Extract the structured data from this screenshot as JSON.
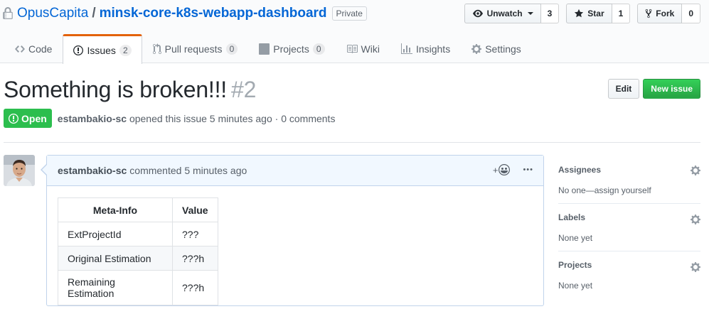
{
  "repo": {
    "owner": "OpusCapita",
    "separator": "/",
    "name": "minsk-core-k8s-webapp-dashboard",
    "visibility": "Private"
  },
  "actions": {
    "watch": {
      "label": "Unwatch",
      "count": "3"
    },
    "star": {
      "label": "Star",
      "count": "1"
    },
    "fork": {
      "label": "Fork",
      "count": "0"
    }
  },
  "tabs": [
    {
      "label": "Code",
      "icon": "code-icon"
    },
    {
      "label": "Issues",
      "icon": "issue-opened-icon",
      "counter": "2",
      "selected": true
    },
    {
      "label": "Pull requests",
      "icon": "git-pull-request-icon",
      "counter": "0"
    },
    {
      "label": "Projects",
      "icon": "project-icon",
      "counter": "0"
    },
    {
      "label": "Wiki",
      "icon": "book-icon"
    },
    {
      "label": "Insights",
      "icon": "graph-icon"
    },
    {
      "label": "Settings",
      "icon": "gear-icon"
    }
  ],
  "issue": {
    "title": "Something is broken!!!",
    "number": "#2",
    "state": "Open",
    "author": "estambakio-sc",
    "meta_text": "opened this issue 5 minutes ago · 0 comments",
    "edit_label": "Edit",
    "new_issue_label": "New issue"
  },
  "comment": {
    "author": "estambakio-sc",
    "action_text": "commented 5 minutes ago",
    "add_reaction": "+",
    "more": "•••",
    "table": {
      "headers": [
        "Meta-Info",
        "Value"
      ],
      "rows": [
        [
          "ExtProjectId",
          "???"
        ],
        [
          "Original Estimation",
          "???h"
        ],
        [
          "Remaining Estimation",
          "???h"
        ]
      ]
    }
  },
  "sidebar": {
    "assignees": {
      "heading": "Assignees",
      "value": "No one—assign yourself"
    },
    "labels": {
      "heading": "Labels",
      "value": "None yet"
    },
    "projects": {
      "heading": "Projects",
      "value": "None yet"
    }
  },
  "colors": {
    "link": "#0366d6",
    "open_state": "#2cbe4e",
    "new_issue": "#28a745",
    "selected_tab_accent": "#e36209",
    "comment_header_bg": "#f1f8ff"
  }
}
